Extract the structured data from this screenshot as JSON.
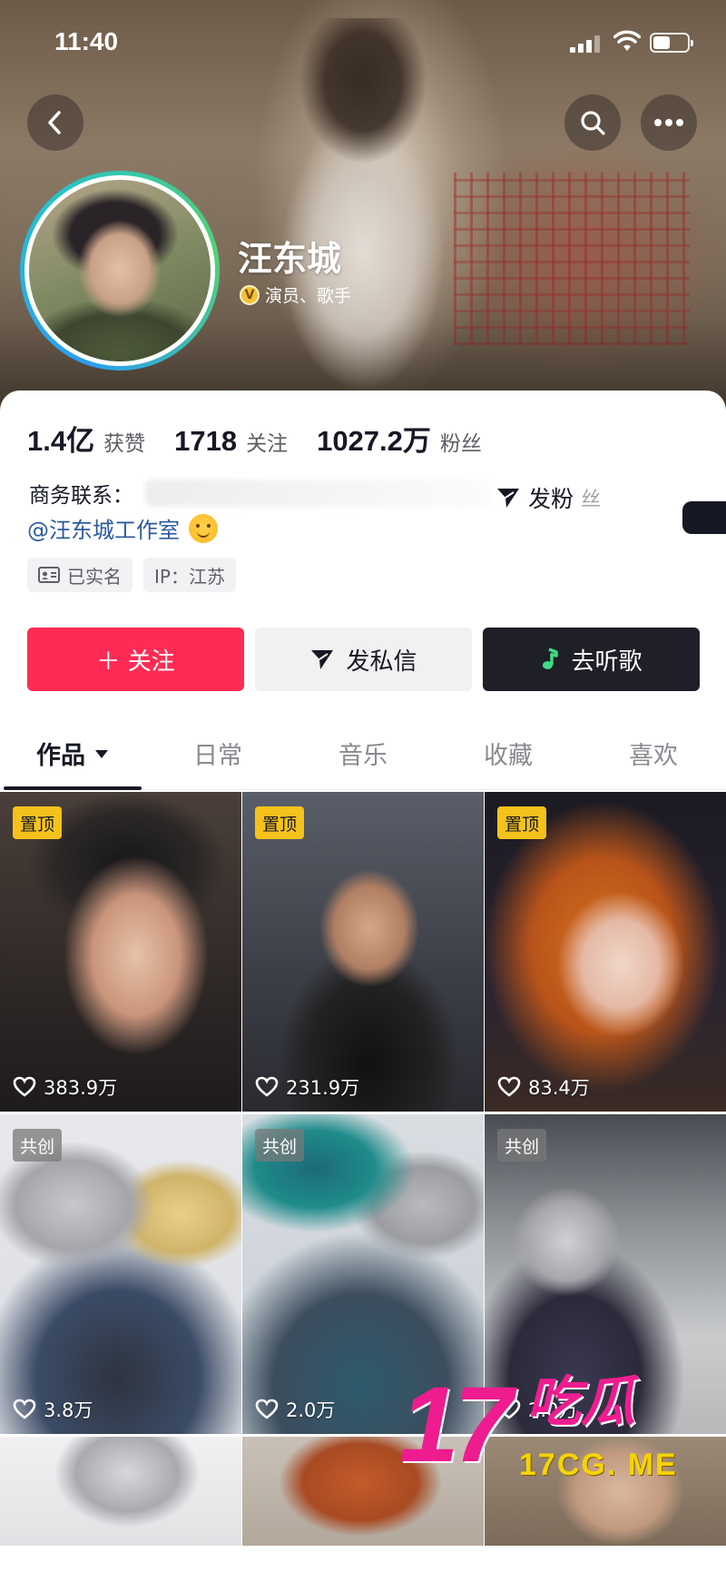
{
  "status_bar": {
    "time": "11:40"
  },
  "profile": {
    "name": "汪东城",
    "verify_badge": "V",
    "verify_text": "演员、歌手"
  },
  "stats": [
    {
      "value": "1.4亿",
      "label": "获赞"
    },
    {
      "value": "1718",
      "label": "关注"
    },
    {
      "value": "1027.2万",
      "label": "粉丝"
    }
  ],
  "bio": {
    "business_contact_label": "商务联系：",
    "studio_link": "@汪东城工作室",
    "fan_group_label": "发粉",
    "fan_group_tail": "丝"
  },
  "tags": [
    {
      "icon": "id-card-icon",
      "label": "已实名"
    },
    {
      "label": "IP：江苏"
    }
  ],
  "actions": {
    "follow": "＋ 关注",
    "message": "发私信",
    "music": "去听歌"
  },
  "tabs": [
    {
      "label": "作品",
      "active": true
    },
    {
      "label": "日常",
      "active": false
    },
    {
      "label": "音乐",
      "active": false
    },
    {
      "label": "收藏",
      "active": false
    },
    {
      "label": "喜欢",
      "active": false
    }
  ],
  "videos": [
    {
      "badge": "置顶",
      "badge_type": "pin",
      "likes": "383.9万"
    },
    {
      "badge": "置顶",
      "badge_type": "pin",
      "likes": "231.9万"
    },
    {
      "badge": "置顶",
      "badge_type": "pin",
      "likes": "83.4万"
    },
    {
      "badge": "共创",
      "badge_type": "collab",
      "likes": "3.8万"
    },
    {
      "badge": "共创",
      "badge_type": "collab",
      "likes": "2.0万"
    },
    {
      "badge": "共创",
      "badge_type": "collab",
      "likes": "2.0万"
    },
    {
      "badge": "",
      "badge_type": "",
      "likes": ""
    },
    {
      "badge": "",
      "badge_type": "",
      "likes": ""
    },
    {
      "badge": "",
      "badge_type": "",
      "likes": ""
    }
  ],
  "watermark": {
    "number": "17",
    "word": "吃瓜",
    "url": "17CG. ME"
  },
  "colors": {
    "follow_red": "#fe2c55",
    "pin_yellow": "#f5c21b",
    "link_blue": "#2c5aa0",
    "watermark_pink": "#ee1c8f"
  }
}
